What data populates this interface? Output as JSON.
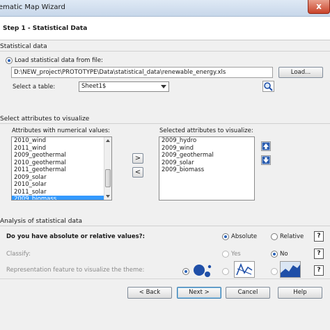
{
  "window": {
    "title": "ematic Map Wizard",
    "close_label": "x"
  },
  "header": {
    "step_title": "Step 1 - Statistical Data"
  },
  "statistical": {
    "section_label": "Statistical data",
    "load_radio_label": "Load statistical data from file:",
    "file_path": "D:\\NEW_project\\PROTOTYPE\\Data\\statistical_data\\renewable_energy.xls",
    "load_button": "Load...",
    "table_label": "Select a table:",
    "table_value": "Sheet1$",
    "search_icon": "magnifier-icon"
  },
  "attributes": {
    "section_label": "Select attributes to visualize",
    "numerical_label": "Attributes with numerical values:",
    "numerical_items": [
      "2010_wind",
      "2011_wind",
      "2009_geothermal",
      "2010_geothermal",
      "2011_geothermal",
      "2009_solar",
      "2010_solar",
      "2011_solar",
      "2009_biomass"
    ],
    "selected_index": 8,
    "scroll_fraction": 0.78,
    "add_button": ">",
    "remove_button": "<",
    "selected_label": "Selected attributes to visualize:",
    "selected_items": [
      "2009_hydro",
      "2009_wind",
      "2009_geothermal",
      "2009_solar",
      "2009_biomass"
    ],
    "move_up_icon": "arrow-up-icon",
    "move_down_icon": "arrow-down-icon"
  },
  "analysis": {
    "section_label": "Analysis of statistical data",
    "values_question": "Do you have absolute or relative values?:",
    "absolute_label": "Absolute",
    "relative_label": "Relative",
    "classify_label": "Classify:",
    "yes_label": "Yes",
    "no_label": "No",
    "representation_label": "Representation feature to visualize the theme:",
    "help_label": "?"
  },
  "footer": {
    "back": "< Back",
    "next": "Next >",
    "cancel": "Cancel",
    "help": "Help"
  },
  "colors": {
    "accent": "#2a62b8",
    "selection": "#3399ff",
    "icon_blue": "#1f4fa8"
  }
}
